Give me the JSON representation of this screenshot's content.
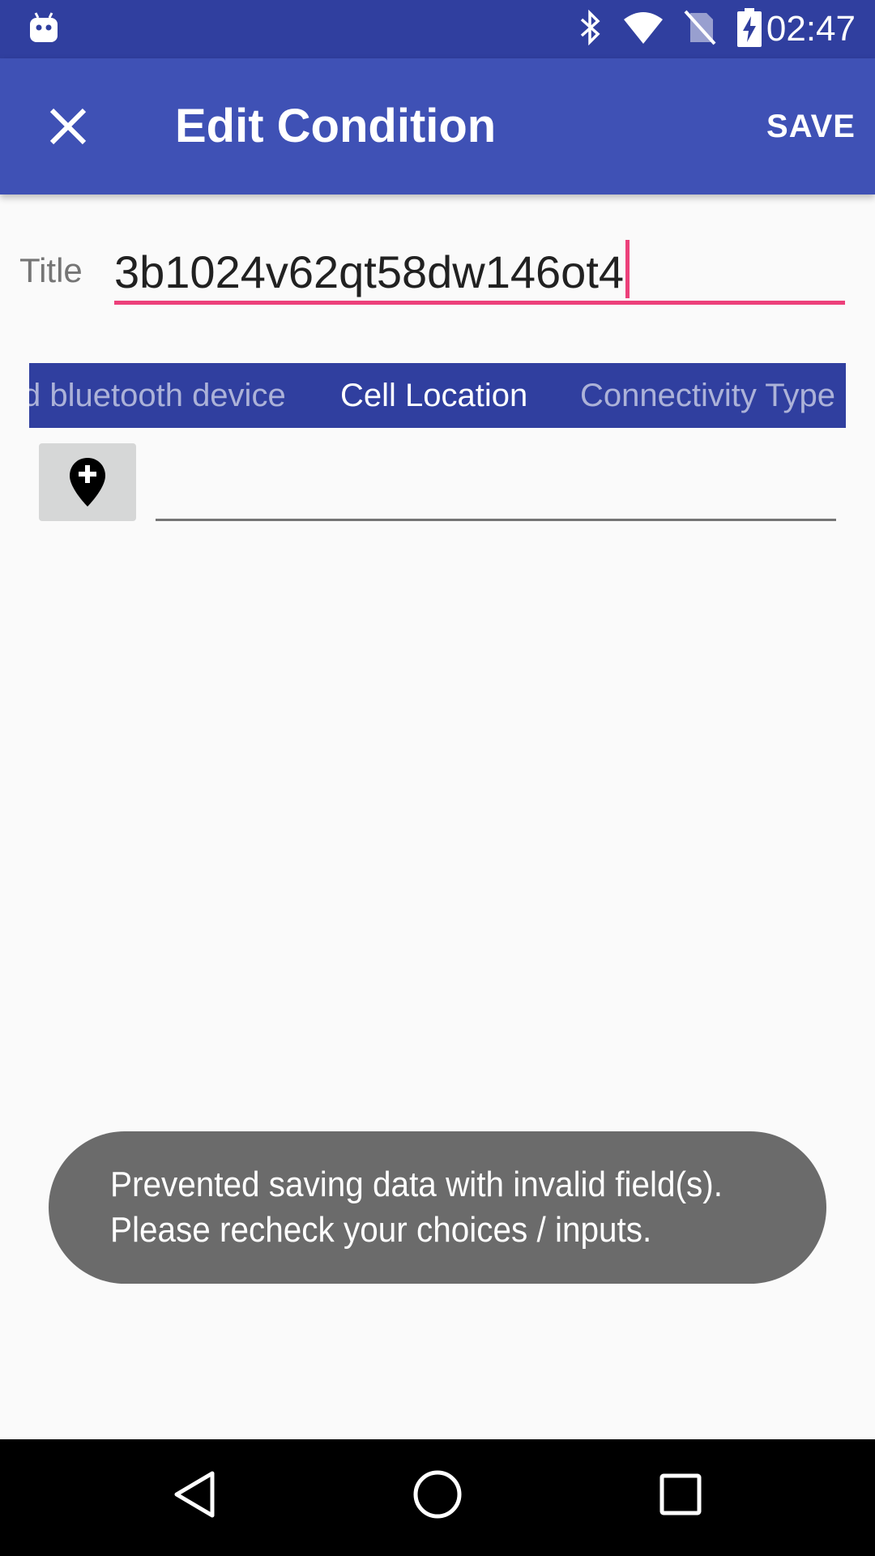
{
  "status_bar": {
    "time": "02:47",
    "icons": [
      "android-robot-icon",
      "bluetooth-icon",
      "wifi-icon",
      "no-sim-icon",
      "battery-charging-icon"
    ]
  },
  "app_bar": {
    "title": "Edit Condition",
    "save_label": "SAVE",
    "close_icon": "close-icon"
  },
  "form": {
    "title_label": "Title",
    "title_value": "3b1024v62qt58dw146ot4"
  },
  "tabs": [
    {
      "label": "d bluetooth device",
      "active": false
    },
    {
      "label": "Cell Location",
      "active": true
    },
    {
      "label": "Connectivity Type",
      "active": false
    }
  ],
  "location": {
    "button_icon": "add-location-icon",
    "value": ""
  },
  "toast": {
    "line1": "Prevented saving data with invalid field(s).",
    "line2": "Please recheck your choices / inputs."
  },
  "nav_bar": {
    "icons": [
      "back-icon",
      "home-icon",
      "recents-icon"
    ]
  },
  "colors": {
    "status_bar": "#303f9f",
    "app_bar": "#3f51b5",
    "accent": "#ec407a",
    "toast": "#6b6b6b"
  }
}
